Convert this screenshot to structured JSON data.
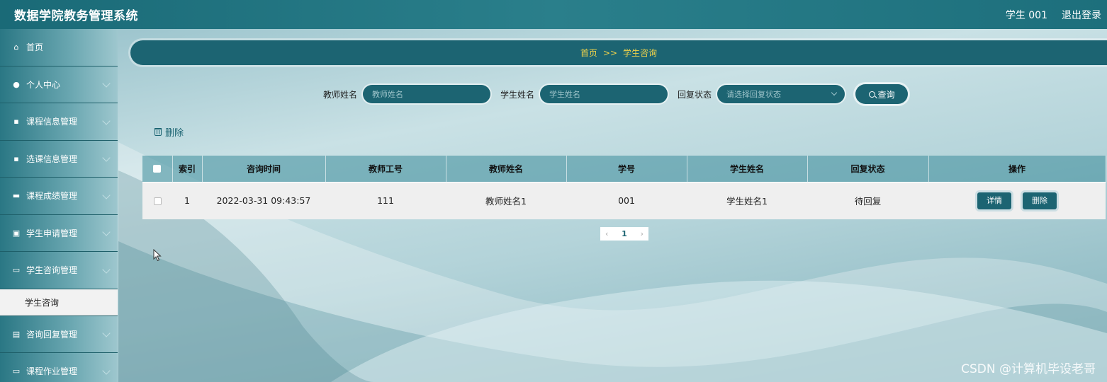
{
  "header": {
    "title": "数据学院教务管理系统",
    "user": "学生 001",
    "logout": "退出登录"
  },
  "sidebar": {
    "items": [
      {
        "label": "首页",
        "icon": "home-icon"
      },
      {
        "label": "个人中心",
        "icon": "user-icon"
      },
      {
        "label": "课程信息管理",
        "icon": "grid-icon"
      },
      {
        "label": "选课信息管理",
        "icon": "grid-icon"
      },
      {
        "label": "课程成绩管理",
        "icon": "comment-icon"
      },
      {
        "label": "学生申请管理",
        "icon": "chart-icon"
      },
      {
        "label": "学生咨询管理",
        "icon": "monitor-icon"
      },
      {
        "label": "咨询回复管理",
        "icon": "document-icon"
      },
      {
        "label": "课程作业管理",
        "icon": "monitor-icon"
      }
    ],
    "active_sub": "学生咨询"
  },
  "breadcrumb": {
    "home": "首页",
    "sep": ">>",
    "current": "学生咨询"
  },
  "search": {
    "teacher_label": "教师姓名",
    "teacher_placeholder": "教师姓名",
    "student_label": "学生姓名",
    "student_placeholder": "学生姓名",
    "status_label": "回复状态",
    "status_placeholder": "请选择回复状态",
    "query_button": "查询"
  },
  "toolbar": {
    "delete": "删除"
  },
  "table": {
    "columns": [
      "索引",
      "咨询时间",
      "教师工号",
      "教师姓名",
      "学号",
      "学生姓名",
      "回复状态",
      "操作"
    ],
    "rows": [
      {
        "index": "1",
        "time": "2022-03-31 09:43:57",
        "teacher_id": "111",
        "teacher_name": "教师姓名1",
        "student_id": "001",
        "student_name": "学生姓名1",
        "status": "待回复",
        "detail": "详情",
        "delete": "删除"
      }
    ]
  },
  "pager": {
    "prev": "‹",
    "page": "1",
    "next": "›"
  },
  "watermark": "CSDN @计算机毕设老哥",
  "colors": {
    "accent": "#1c6472",
    "crumb_text": "#f0d24a"
  }
}
